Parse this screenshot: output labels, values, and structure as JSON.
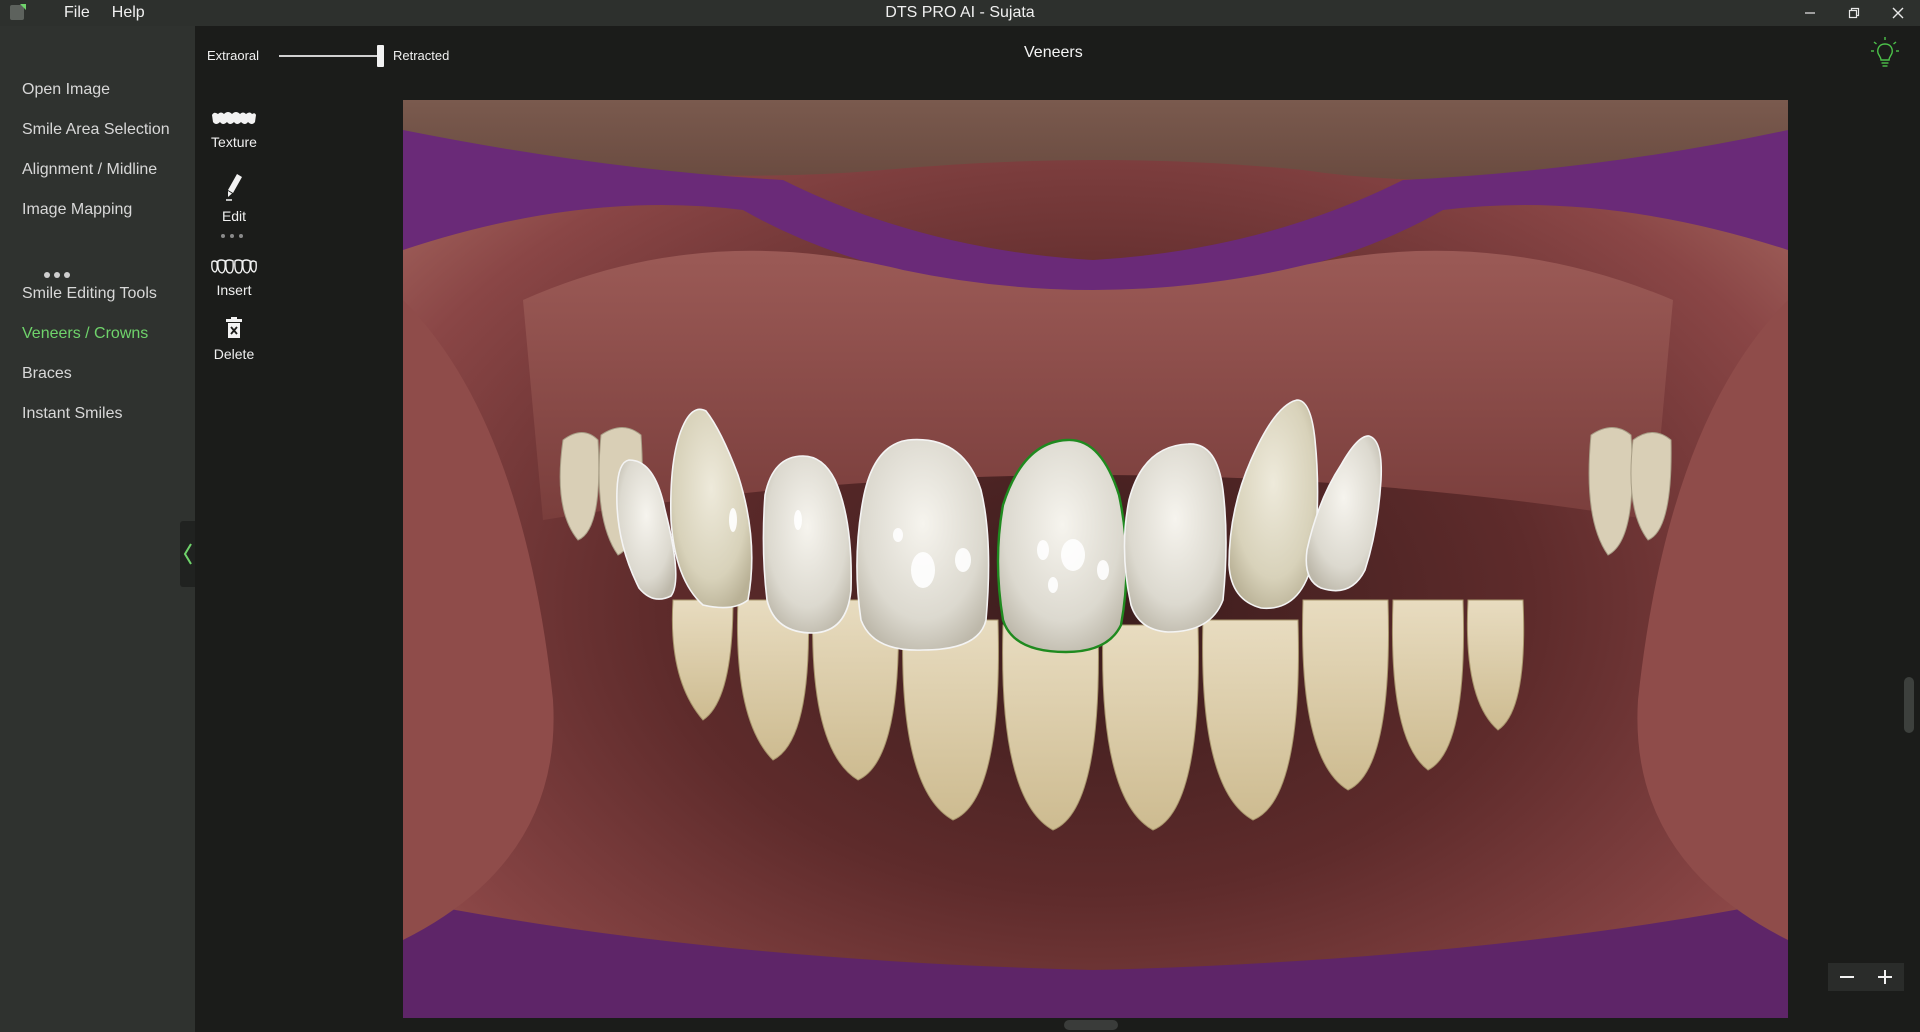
{
  "window": {
    "title": "DTS PRO AI - Sujata",
    "menu": [
      "File",
      "Help"
    ]
  },
  "sidebar": {
    "items": [
      {
        "label": "Open Image",
        "active": false
      },
      {
        "label": "Smile Area Selection",
        "active": false
      },
      {
        "label": "Alignment / Midline",
        "active": false
      },
      {
        "label": "Image Mapping",
        "active": false
      },
      {
        "label": "Smile Editing Tools",
        "active": false
      },
      {
        "label": "Veneers / Crowns",
        "active": true
      },
      {
        "label": "Braces",
        "active": false
      },
      {
        "label": "Instant Smiles",
        "active": false
      }
    ]
  },
  "toolbar": {
    "left_label": "Extraoral",
    "right_label": "Retracted",
    "slider_value": 1.0,
    "section_title": "Veneers"
  },
  "tools": {
    "items": [
      {
        "label": "Texture",
        "icon": "texture-icon"
      },
      {
        "label": "Edit",
        "icon": "pen-icon"
      },
      {
        "label": "Insert",
        "icon": "insert-teeth-icon"
      },
      {
        "label": "Delete",
        "icon": "trash-icon"
      }
    ]
  },
  "colors": {
    "accent": "#6fd36b",
    "selected_outline": "#1f8a1f",
    "sidebar_bg": "#2f322f",
    "app_bg": "#1b1c1a"
  },
  "image": {
    "description_icon": "dental-retracted-photo",
    "selected_veneer_index": 4
  }
}
